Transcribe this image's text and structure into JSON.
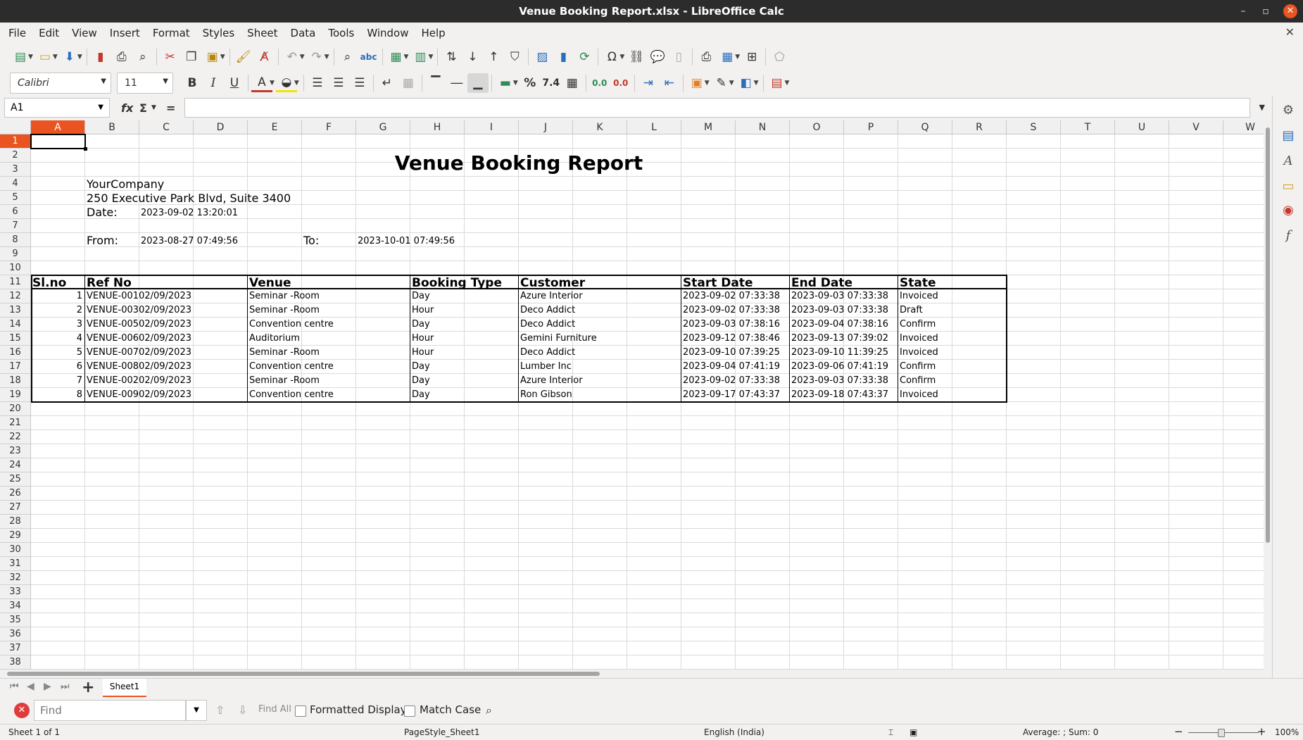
{
  "window": {
    "title": "Venue Booking Report.xlsx - LibreOffice Calc"
  },
  "menu": [
    "File",
    "Edit",
    "View",
    "Insert",
    "Format",
    "Styles",
    "Sheet",
    "Data",
    "Tools",
    "Window",
    "Help"
  ],
  "font": {
    "name": "Calibri",
    "size": "11"
  },
  "toolbar2_labels": {
    "bold": "B",
    "italic": "I",
    "underline": "U",
    "percent": "%",
    "number": "7.4",
    "add_decimal": "0.0",
    "del_decimal": "0.0"
  },
  "formula": {
    "cell_ref": "A1",
    "fx": "fx",
    "sum": "Σ",
    "equals": "=",
    "content": ""
  },
  "columns": [
    "A",
    "B",
    "C",
    "D",
    "E",
    "F",
    "G",
    "H",
    "I",
    "J",
    "K",
    "L",
    "M",
    "N",
    "O",
    "P",
    "Q",
    "R",
    "S",
    "T",
    "U",
    "V",
    "W"
  ],
  "rows": [
    "1",
    "2",
    "3",
    "4",
    "5",
    "6",
    "7",
    "8",
    "9",
    "10",
    "11",
    "12",
    "13",
    "14",
    "15",
    "16",
    "17",
    "18",
    "19",
    "20",
    "21",
    "22",
    "23",
    "24",
    "25",
    "26",
    "27",
    "28",
    "29",
    "30",
    "31",
    "32",
    "33",
    "34",
    "35",
    "36",
    "37",
    "38"
  ],
  "report": {
    "title": "Venue Booking Report",
    "company": "YourCompany",
    "address": "250 Executive Park Blvd, Suite 3400",
    "date_label": "Date:",
    "date_value": "2023-09-02 13:20:01",
    "from_label": "From:",
    "from_value": "2023-08-27 07:49:56",
    "to_label": "To:",
    "to_value": "2023-10-01 07:49:56"
  },
  "table": {
    "headers": [
      "Sl.no",
      "Ref No",
      "Venue",
      "Booking Type",
      "Customer",
      "Start Date",
      "End Date",
      "State"
    ],
    "rows": [
      [
        "1",
        "VENUE-00102/09/2023",
        "Seminar -Room",
        "Day",
        "Azure Interior",
        "2023-09-02 07:33:38",
        "2023-09-03 07:33:38",
        "Invoiced"
      ],
      [
        "2",
        "VENUE-00302/09/2023",
        "Seminar -Room",
        "Hour",
        "Deco Addict",
        "2023-09-02 07:33:38",
        "2023-09-03 07:33:38",
        "Draft"
      ],
      [
        "3",
        "VENUE-00502/09/2023",
        "Convention centre",
        "Day",
        "Deco Addict",
        "2023-09-03 07:38:16",
        "2023-09-04 07:38:16",
        "Confirm"
      ],
      [
        "4",
        "VENUE-00602/09/2023",
        "Auditorium",
        "Hour",
        "Gemini Furniture",
        "2023-09-12 07:38:46",
        "2023-09-13 07:39:02",
        "Invoiced"
      ],
      [
        "5",
        "VENUE-00702/09/2023",
        "Seminar -Room",
        "Hour",
        "Deco Addict",
        "2023-09-10 07:39:25",
        "2023-09-10 11:39:25",
        "Invoiced"
      ],
      [
        "6",
        "VENUE-00802/09/2023",
        "Convention centre",
        "Day",
        "Lumber Inc",
        "2023-09-04 07:41:19",
        "2023-09-06 07:41:19",
        "Confirm"
      ],
      [
        "7",
        "VENUE-00202/09/2023",
        "Seminar -Room",
        "Day",
        "Azure Interior",
        "2023-09-02 07:33:38",
        "2023-09-03 07:33:38",
        "Confirm"
      ],
      [
        "8",
        "VENUE-00902/09/2023",
        "Convention centre",
        "Day",
        "Ron Gibson",
        "2023-09-17 07:43:37",
        "2023-09-18 07:43:37",
        "Invoiced"
      ]
    ]
  },
  "sheet_tab": "Sheet1",
  "find": {
    "placeholder": "Find",
    "find_all": "Find All",
    "formatted_display": "Formatted Display",
    "match_case": "Match Case"
  },
  "status": {
    "sheet": "Sheet 1 of 1",
    "page_style": "PageStyle_Sheet1",
    "language": "English (India)",
    "summary": "Average: ; Sum: 0",
    "zoom": "100%"
  },
  "accent_color": "#e95420"
}
